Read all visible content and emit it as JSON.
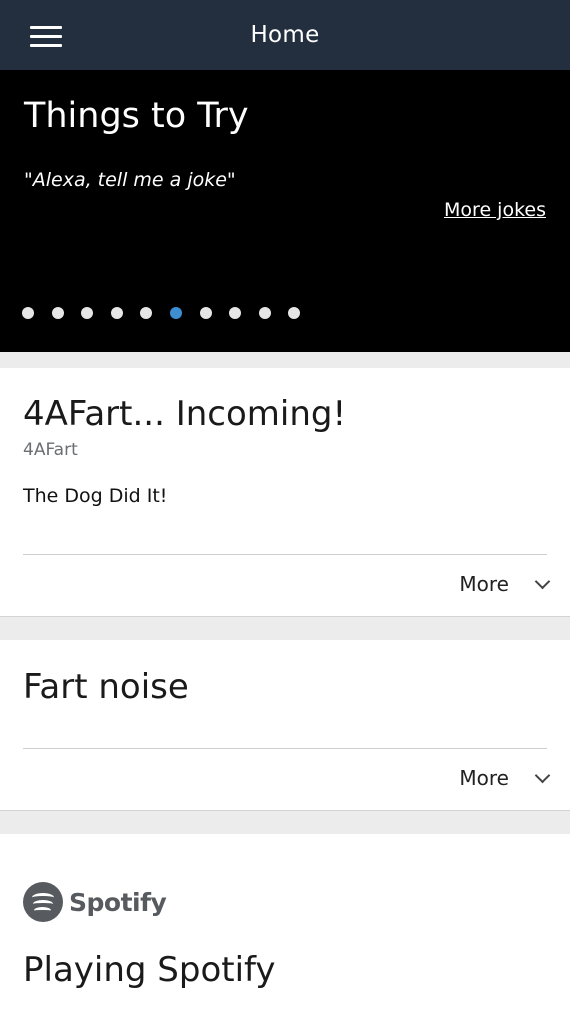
{
  "header": {
    "title": "Home"
  },
  "hero": {
    "title": "Things to Try",
    "quote": "\"Alexa, tell me a joke\"",
    "link": "More jokes",
    "dots_total": 10,
    "active_dot": 6,
    "colors": {
      "active": "#3d8fd1",
      "inactive": "#e6e6e6"
    }
  },
  "cards": [
    {
      "title": "4AFart... Incoming!",
      "subtitle": "4AFart",
      "body": "The Dog Did It!",
      "more_label": "More"
    },
    {
      "title": "Fart noise",
      "more_label": "More"
    },
    {
      "brand": "Spotify",
      "title": "Playing Spotify"
    }
  ],
  "theme": {
    "header_bg": "#232f3e",
    "page_bg": "#ececec"
  }
}
